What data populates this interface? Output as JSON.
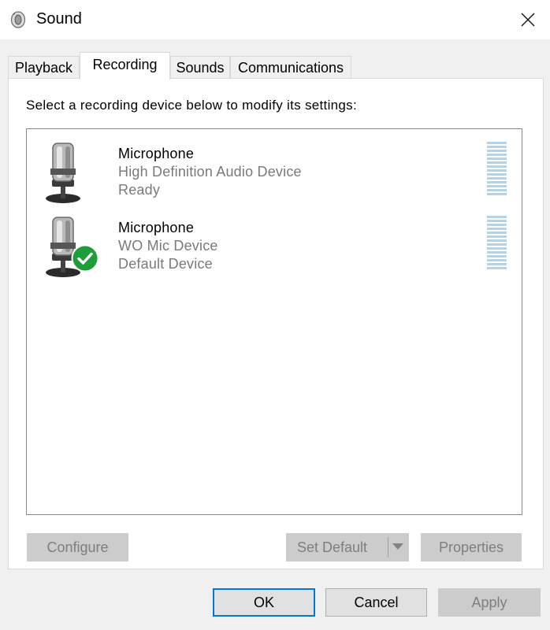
{
  "window": {
    "title": "Sound",
    "icon": "speaker-icon",
    "close_icon": "close-icon"
  },
  "tabs": [
    {
      "label": "Playback",
      "active": false
    },
    {
      "label": "Recording",
      "active": true
    },
    {
      "label": "Sounds",
      "active": false
    },
    {
      "label": "Communications",
      "active": false
    }
  ],
  "panel": {
    "instruction": "Select a recording device below to modify its settings:"
  },
  "devices": [
    {
      "name": "Microphone",
      "description": "High Definition Audio Device",
      "status": "Ready",
      "icon": "microphone-icon",
      "is_default": false,
      "level_meter": 0
    },
    {
      "name": "Microphone",
      "description": "WO Mic Device",
      "status": "Default Device",
      "icon": "microphone-icon",
      "badge_icon": "green-check-icon",
      "is_default": true,
      "level_meter": 0
    }
  ],
  "panel_buttons": {
    "configure": {
      "label": "Configure",
      "enabled": false
    },
    "set_default": {
      "label": "Set Default",
      "enabled": false
    },
    "properties": {
      "label": "Properties",
      "enabled": false
    }
  },
  "dialog_buttons": {
    "ok": {
      "label": "OK",
      "enabled": true,
      "default": true
    },
    "cancel": {
      "label": "Cancel",
      "enabled": true
    },
    "apply": {
      "label": "Apply",
      "enabled": false
    }
  },
  "colors": {
    "accent": "#0078d7",
    "check_badge": "#1e9e3b",
    "meter_bar": "#b6d3e6",
    "disabled_text": "#7e7e7e"
  }
}
